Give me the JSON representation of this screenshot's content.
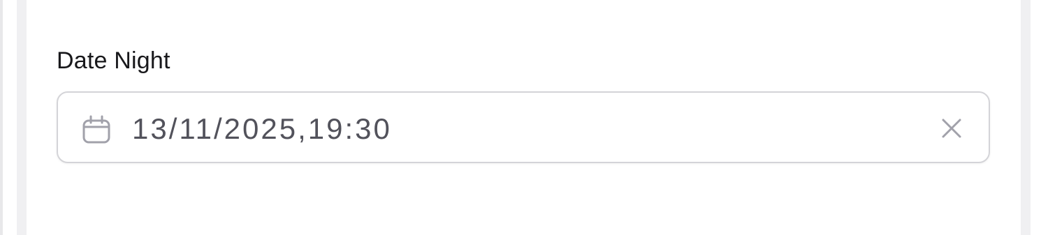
{
  "field": {
    "label": "Date Night",
    "value": "13/11/2025,19:30"
  },
  "icons": {
    "leading": "calendar-icon",
    "trailing": "close-icon"
  },
  "colors": {
    "label": "#18181b",
    "value": "#52525b",
    "icon": "#a1a1aa",
    "border": "#d4d4d8"
  }
}
